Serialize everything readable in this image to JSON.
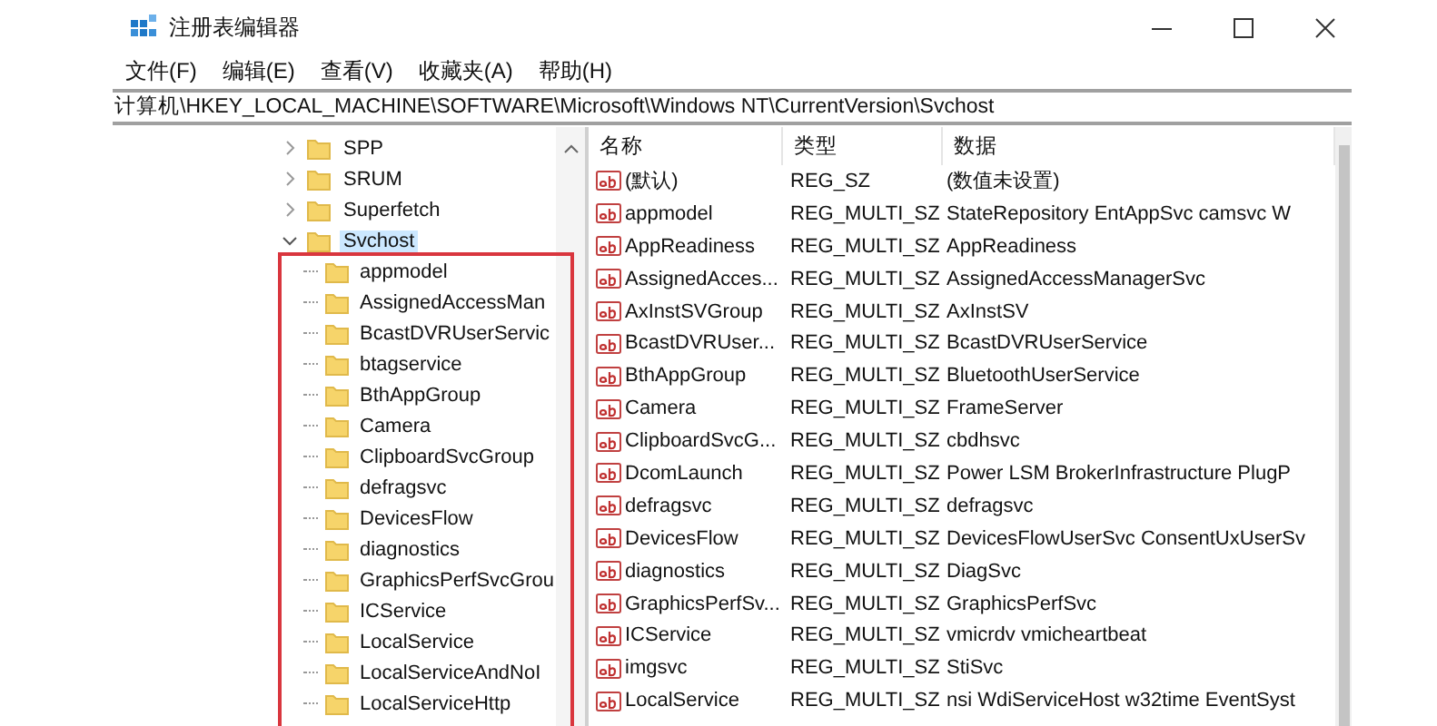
{
  "window": {
    "title": "注册表编辑器"
  },
  "menu": [
    "文件(F)",
    "编辑(E)",
    "查看(V)",
    "收藏夹(A)",
    "帮助(H)"
  ],
  "address": "计算机\\HKEY_LOCAL_MACHINE\\SOFTWARE\\Microsoft\\Windows NT\\CurrentVersion\\Svchost",
  "tree": {
    "items": [
      {
        "label": "SPP",
        "expanded": false,
        "selected": false
      },
      {
        "label": "SRUM",
        "expanded": false,
        "selected": false
      },
      {
        "label": "Superfetch",
        "expanded": false,
        "selected": false
      },
      {
        "label": "Svchost",
        "expanded": true,
        "selected": true,
        "children": [
          {
            "label": "appmodel",
            "selected": false
          },
          {
            "label": "AssignedAccessMan",
            "selected": false
          },
          {
            "label": "BcastDVRUserServic",
            "selected": false
          },
          {
            "label": "btagservice",
            "selected": false
          },
          {
            "label": "BthAppGroup",
            "selected": false
          },
          {
            "label": "Camera",
            "selected": false
          },
          {
            "label": "ClipboardSvcGroup",
            "selected": false
          },
          {
            "label": "defragsvc",
            "selected": false
          },
          {
            "label": "DevicesFlow",
            "selected": false
          },
          {
            "label": "diagnostics",
            "selected": false
          },
          {
            "label": "GraphicsPerfSvcGrou",
            "selected": false
          },
          {
            "label": "ICService",
            "selected": false
          },
          {
            "label": "LocalService",
            "selected": false
          },
          {
            "label": "LocalServiceAndNoI",
            "selected": false
          },
          {
            "label": "LocalServiceHttp",
            "selected": false
          }
        ]
      }
    ]
  },
  "list": {
    "columns": [
      "名称",
      "类型",
      "数据"
    ],
    "rows": [
      {
        "name": "(默认)",
        "type": "REG_SZ",
        "data": "(数值未设置)"
      },
      {
        "name": "appmodel",
        "type": "REG_MULTI_SZ",
        "data": "StateRepository EntAppSvc camsvc W"
      },
      {
        "name": "AppReadiness",
        "type": "REG_MULTI_SZ",
        "data": "AppReadiness"
      },
      {
        "name": "AssignedAcces...",
        "type": "REG_MULTI_SZ",
        "data": "AssignedAccessManagerSvc"
      },
      {
        "name": "AxInstSVGroup",
        "type": "REG_MULTI_SZ",
        "data": "AxInstSV"
      },
      {
        "name": "BcastDVRUser...",
        "type": "REG_MULTI_SZ",
        "data": "BcastDVRUserService"
      },
      {
        "name": "BthAppGroup",
        "type": "REG_MULTI_SZ",
        "data": "BluetoothUserService"
      },
      {
        "name": "Camera",
        "type": "REG_MULTI_SZ",
        "data": "FrameServer"
      },
      {
        "name": "ClipboardSvcG...",
        "type": "REG_MULTI_SZ",
        "data": "cbdhsvc"
      },
      {
        "name": "DcomLaunch",
        "type": "REG_MULTI_SZ",
        "data": "Power LSM BrokerInfrastructure PlugP"
      },
      {
        "name": "defragsvc",
        "type": "REG_MULTI_SZ",
        "data": "defragsvc"
      },
      {
        "name": "DevicesFlow",
        "type": "REG_MULTI_SZ",
        "data": "DevicesFlowUserSvc ConsentUxUserSv"
      },
      {
        "name": "diagnostics",
        "type": "REG_MULTI_SZ",
        "data": "DiagSvc"
      },
      {
        "name": "GraphicsPerfSv...",
        "type": "REG_MULTI_SZ",
        "data": "GraphicsPerfSvc"
      },
      {
        "name": "ICService",
        "type": "REG_MULTI_SZ",
        "data": "vmicrdv vmicheartbeat"
      },
      {
        "name": "imgsvc",
        "type": "REG_MULTI_SZ",
        "data": "StiSvc"
      },
      {
        "name": "LocalService",
        "type": "REG_MULTI_SZ",
        "data": "nsi WdiServiceHost w32time EventSyst"
      }
    ]
  },
  "highlight": {
    "kind": "frame"
  }
}
